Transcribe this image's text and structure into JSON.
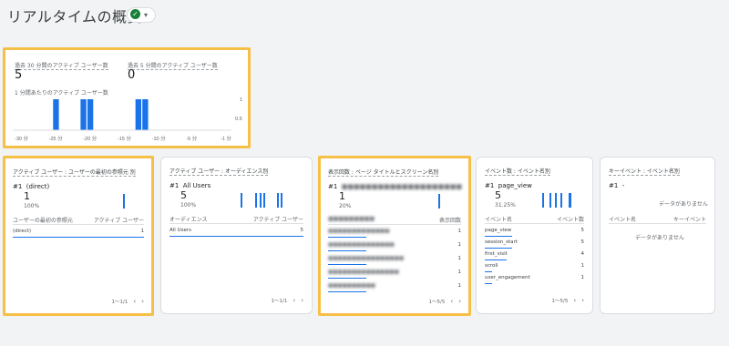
{
  "page": {
    "title": "リアルタイムの概要"
  },
  "overview": {
    "users_30_label": "過去 30 分間のアクティブ ユーザー数",
    "users_30_value": "5",
    "users_5_label": "過去 5 分間のアクティブ ユーザー数",
    "users_5_value": "0",
    "per_minute_label": "1 分間あたりのアクティブ ユーザー数",
    "y_ticks": [
      "1",
      "0.5"
    ],
    "x_ticks": [
      "-30 分",
      "-25 分",
      "-20 分",
      "-15 分",
      "-10 分",
      "-5 分",
      "-1 分"
    ]
  },
  "chart_data": {
    "type": "bar",
    "ylim": [
      0,
      1
    ],
    "x": [
      -30,
      -29,
      -28,
      -27,
      -26,
      -25,
      -24,
      -23,
      -22,
      -21,
      -20,
      -19,
      -18,
      -17,
      -16,
      -15,
      -14,
      -13,
      -12,
      -11,
      -10,
      -9,
      -8,
      -7,
      -6,
      -5,
      -4,
      -3,
      -2,
      -1
    ],
    "values": [
      0,
      0,
      0,
      0,
      0,
      1,
      0,
      0,
      0,
      1,
      1,
      0,
      0,
      0,
      0,
      0,
      0,
      1,
      1,
      0,
      0,
      0,
      0,
      0,
      0,
      0,
      0,
      0,
      0,
      0
    ]
  },
  "cards": [
    {
      "title": "アクティブ ユーザー : ユーザーの最初の参照元 別",
      "rank": "#1",
      "top_name": "(direct)",
      "top_value": "1",
      "top_pct": "100%",
      "col1": "ユーザーの最初の参照元",
      "col2": "アクティブ ユーザー",
      "rows": [
        {
          "name": "(direct)",
          "value": "1"
        }
      ],
      "pager": "1〜1/1",
      "prev": "‹",
      "next": "›"
    },
    {
      "title": "アクティブ ユーザー : オーディエンス別",
      "rank": "#1",
      "top_name": "All Users",
      "top_value": "5",
      "top_pct": "100%",
      "col1": "オーディエンス",
      "col2": "アクティブ ユーザー",
      "rows": [
        {
          "name": "All Users",
          "value": "5"
        }
      ],
      "pager": "1〜1/1",
      "prev": "‹",
      "next": "›"
    },
    {
      "title": "表示回数 : ページ タイトルとスクリーン名別",
      "rank": "#1",
      "top_value": "1",
      "top_pct": "20%",
      "col2": "表示回数",
      "rows": [
        {
          "value": "1"
        },
        {
          "value": "1"
        },
        {
          "value": "1"
        },
        {
          "value": "1"
        },
        {
          "value": "1"
        }
      ],
      "pager": "1〜5/5",
      "prev": "‹",
      "next": "›"
    },
    {
      "title": "イベント数 : イベント名別",
      "rank": "#1",
      "top_name": "page_view",
      "top_value": "5",
      "top_pct": "31.25%",
      "col1": "イベント名",
      "col2": "イベント数",
      "rows": [
        {
          "name": "page_view",
          "value": "5"
        },
        {
          "name": "session_start",
          "value": "5"
        },
        {
          "name": "first_visit",
          "value": "4"
        },
        {
          "name": "scroll",
          "value": "1"
        },
        {
          "name": "user_engagement",
          "value": "1"
        }
      ],
      "pager": "1〜5/5",
      "prev": "‹",
      "next": "›"
    },
    {
      "title": "キーイベント : イベント名別",
      "rank": "#1",
      "top_name": "-",
      "no_data": "データがありません",
      "col1": "イベント名",
      "col2": "キーイベント",
      "no_data_2": "データがありません"
    }
  ],
  "colors": {
    "accent": "#1a73e8",
    "highlight": "#f6c048"
  }
}
